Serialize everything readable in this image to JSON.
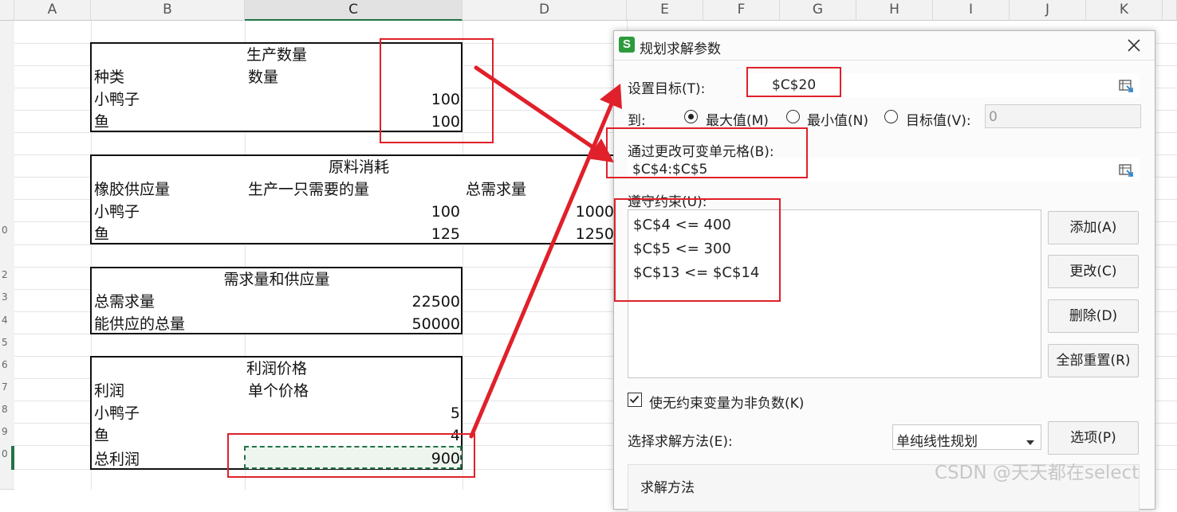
{
  "spreadsheet": {
    "columns": [
      "A",
      "B",
      "C",
      "D",
      "E",
      "F",
      "G",
      "H",
      "I",
      "J",
      "K"
    ],
    "selected_column": "C",
    "row_marks": [
      "0",
      "2",
      "3",
      "4",
      "5",
      "6",
      "7",
      "8",
      "9",
      "0"
    ],
    "production": {
      "title": "生产数量",
      "header_kind": "种类",
      "header_qty": "数量",
      "rows": [
        {
          "name": "小鸭子",
          "value": "100"
        },
        {
          "name": "鱼",
          "value": "100"
        }
      ]
    },
    "materials": {
      "title": "原料消耗",
      "header_supply": "橡胶供应量",
      "header_per_unit": "生产一只需要的量",
      "header_total": "总需求量",
      "rows": [
        {
          "name": "小鸭子",
          "per_unit": "100",
          "total": "1000"
        },
        {
          "name": "鱼",
          "per_unit": "125",
          "total": "1250"
        }
      ]
    },
    "demand_supply": {
      "title": "需求量和供应量",
      "rows": [
        {
          "name": "总需求量",
          "value": "22500"
        },
        {
          "name": "能供应的总量",
          "value": "50000"
        }
      ]
    },
    "profit": {
      "title": "利润价格",
      "header_profit": "利润",
      "header_price": "单个价格",
      "rows": [
        {
          "name": "小鸭子",
          "value": "5"
        },
        {
          "name": "鱼",
          "value": "4"
        },
        {
          "name": "总利润",
          "value": "900"
        }
      ]
    }
  },
  "dialog": {
    "app_icon_letter": "S",
    "title": "规划求解参数",
    "set_objective_label": "设置目标(T):",
    "set_objective_value": "$C$20",
    "to_label": "到:",
    "radio_max": "最大值(M)",
    "radio_min": "最小值(N)",
    "radio_target": "目标值(V):",
    "target_value": "0",
    "selected_radio": "max",
    "changing_cells_label": "通过更改可变单元格(B):",
    "changing_cells_value": "$C$4:$C$5",
    "constraints_label": "遵守约束(U):",
    "constraints": [
      "$C$4 <= 400",
      "$C$5 <= 300",
      "$C$13 <= $C$14"
    ],
    "btn_add": "添加(A)",
    "btn_change": "更改(C)",
    "btn_delete": "删除(D)",
    "btn_reset_all": "全部重置(R)",
    "nonneg_label": "使无约束变量为非负数(K)",
    "nonneg_checked": true,
    "method_label": "选择求解方法(E):",
    "method_value": "单纯线性规划",
    "btn_options": "选项(P)",
    "method_section_label": "求解方法"
  },
  "watermark": "CSDN @天天都在select",
  "colors": {
    "annotation_red": "#e0202a",
    "excel_green": "#217346"
  }
}
